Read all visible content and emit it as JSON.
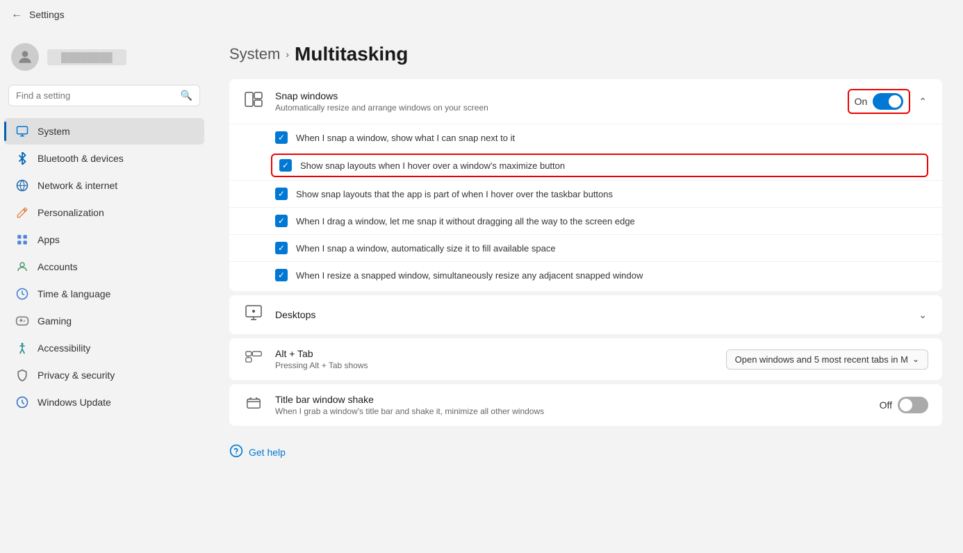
{
  "titleBar": {
    "title": "Settings",
    "backLabel": "←"
  },
  "user": {
    "name": "User Name"
  },
  "search": {
    "placeholder": "Find a setting"
  },
  "nav": {
    "items": [
      {
        "id": "system",
        "label": "System",
        "icon": "🖥",
        "active": true
      },
      {
        "id": "bluetooth",
        "label": "Bluetooth & devices",
        "icon": "🔵"
      },
      {
        "id": "network",
        "label": "Network & internet",
        "icon": "🌐"
      },
      {
        "id": "personalization",
        "label": "Personalization",
        "icon": "✏️"
      },
      {
        "id": "apps",
        "label": "Apps",
        "icon": "📦"
      },
      {
        "id": "accounts",
        "label": "Accounts",
        "icon": "👤"
      },
      {
        "id": "time",
        "label": "Time & language",
        "icon": "🌍"
      },
      {
        "id": "gaming",
        "label": "Gaming",
        "icon": "🎮"
      },
      {
        "id": "accessibility",
        "label": "Accessibility",
        "icon": "♿"
      },
      {
        "id": "privacy",
        "label": "Privacy & security",
        "icon": "🔒"
      },
      {
        "id": "update",
        "label": "Windows Update",
        "icon": "🔄"
      }
    ]
  },
  "page": {
    "breadcrumb": "System",
    "title": "Multitasking"
  },
  "snapWindows": {
    "title": "Snap windows",
    "subtitle": "Automatically resize and arrange windows on your screen",
    "toggleState": "On",
    "toggleOn": true,
    "checkboxItems": [
      {
        "id": "cb1",
        "label": "When I snap a window, show what I can snap next to it",
        "checked": true
      },
      {
        "id": "cb2",
        "label": "Show snap layouts when I hover over a window's maximize button",
        "checked": true,
        "highlighted": true
      },
      {
        "id": "cb3",
        "label": "Show snap layouts that the app is part of when I hover over the taskbar buttons",
        "checked": true
      },
      {
        "id": "cb4",
        "label": "When I drag a window, let me snap it without dragging all the way to the screen edge",
        "checked": true
      },
      {
        "id": "cb5",
        "label": "When I snap a window, automatically size it to fill available space",
        "checked": true
      },
      {
        "id": "cb6",
        "label": "When I resize a snapped window, simultaneously resize any adjacent snapped window",
        "checked": true
      }
    ]
  },
  "desktops": {
    "title": "Desktops"
  },
  "altTab": {
    "title": "Alt + Tab",
    "subtitle": "Pressing Alt + Tab shows",
    "dropdownValue": "Open windows and 5 most recent tabs in M"
  },
  "titleBarShake": {
    "title": "Title bar window shake",
    "subtitle": "When I grab a window's title bar and shake it, minimize all other windows",
    "toggleState": "Off",
    "toggleOn": false
  },
  "getHelp": {
    "label": "Get help"
  },
  "icons": {
    "back": "←",
    "search": "⚲",
    "chevronDown": "⌄",
    "chevronUp": "⌃",
    "checkmark": "✓"
  }
}
